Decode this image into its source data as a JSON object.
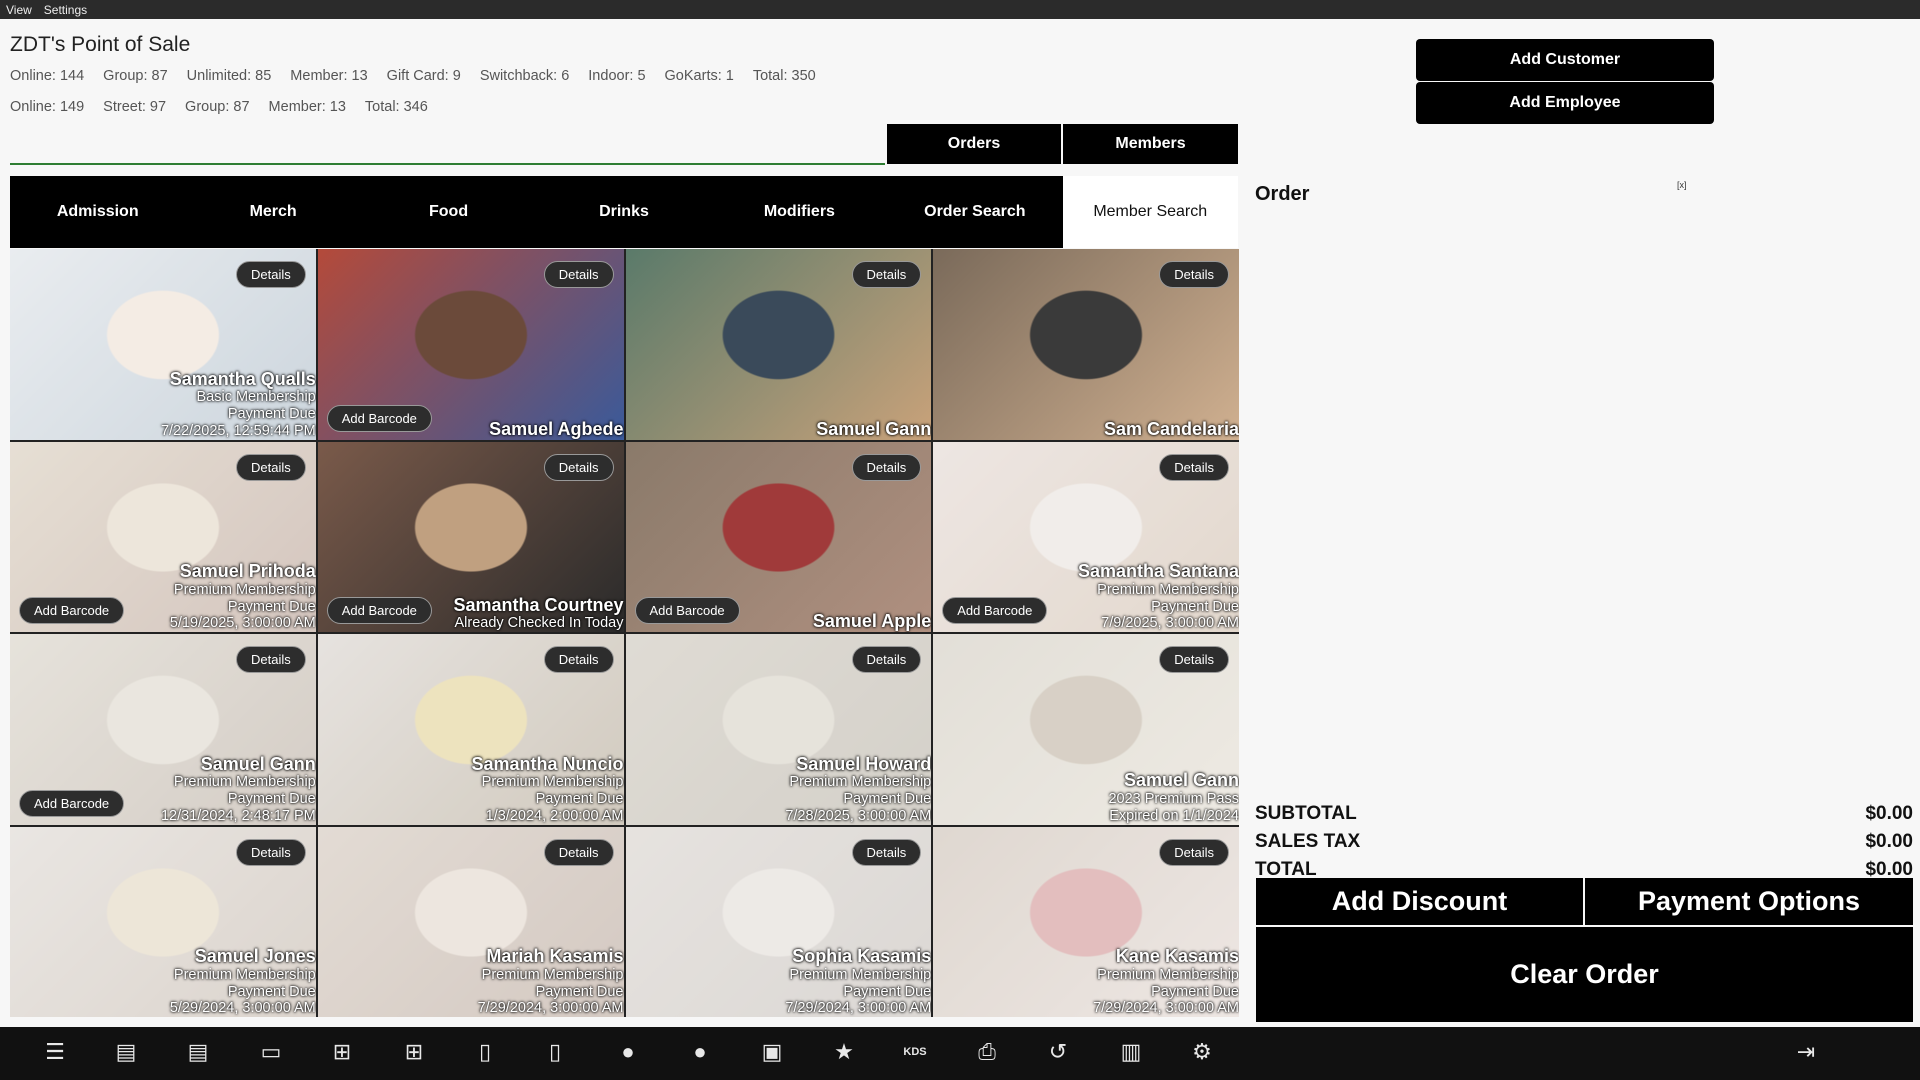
{
  "menu": [
    "View",
    "Settings"
  ],
  "app_title": "ZDT's Point of Sale",
  "stats_row1": [
    "Online: 144",
    "Group: 87",
    "Unlimited: 85",
    "Member: 13",
    "Gift Card: 9",
    "Switchback: 6",
    "Indoor: 5",
    "GoKarts: 1",
    "Total: 350"
  ],
  "stats_row2": [
    "Online: 149",
    "Street: 97",
    "Group: 87",
    "Member: 13",
    "Total: 346"
  ],
  "top_tabs": {
    "orders": "Orders",
    "members": "Members"
  },
  "right_buttons": {
    "add_customer": "Add Customer",
    "add_employee": "Add Employee"
  },
  "categories": [
    "Admission",
    "Merch",
    "Food",
    "Drinks",
    "Modifiers",
    "Order Search",
    "Member Search"
  ],
  "active_category": "Member Search",
  "card_buttons": {
    "details": "Details",
    "add_barcode": "Add Barcode"
  },
  "members": [
    {
      "name": "Samantha Qualls",
      "lines": [
        "Basic Membership",
        "Payment Due",
        "7/22/2025, 12:59:44 PM"
      ],
      "barcode": false,
      "faded": true
    },
    {
      "name": "Samuel Agbede",
      "lines": [],
      "barcode": true,
      "faded": false
    },
    {
      "name": "Samuel Gann",
      "lines": [],
      "barcode": false,
      "faded": false
    },
    {
      "name": "Sam Candelaria",
      "lines": [],
      "barcode": false,
      "faded": false
    },
    {
      "name": "Samuel Prihoda",
      "lines": [
        "Premium Membership",
        "Payment Due",
        "5/19/2025, 3:00:00 AM"
      ],
      "barcode": true,
      "faded": true
    },
    {
      "name": "Samantha Courtney",
      "lines": [
        "Already Checked In Today"
      ],
      "barcode": true,
      "faded": false
    },
    {
      "name": "Samuel Apple",
      "lines": [],
      "barcode": true,
      "faded": false
    },
    {
      "name": "Samantha Santana",
      "lines": [
        "Premium Membership",
        "Payment Due",
        "7/9/2025, 3:00:00 AM"
      ],
      "barcode": true,
      "faded": true
    },
    {
      "name": "Samuel Gann",
      "lines": [
        "Premium Membership",
        "Payment Due",
        "12/31/2024, 2:48:17 PM"
      ],
      "barcode": true,
      "faded": true
    },
    {
      "name": "Samantha Nuncio",
      "lines": [
        "Premium Membership",
        "Payment Due",
        "1/3/2024, 2:00:00 AM"
      ],
      "barcode": false,
      "faded": true
    },
    {
      "name": "Samuel Howard",
      "lines": [
        "Premium Membership",
        "Payment Due",
        "7/28/2025, 3:00:00 AM"
      ],
      "barcode": false,
      "faded": true
    },
    {
      "name": "Samuel Gann",
      "lines": [
        "2023 Premium Pass",
        "Expired on 1/1/2024"
      ],
      "barcode": false,
      "faded": true
    },
    {
      "name": "Samuel Jones",
      "lines": [
        "Premium Membership",
        "Payment Due",
        "5/29/2024, 3:00:00 AM"
      ],
      "barcode": false,
      "faded": true
    },
    {
      "name": "Mariah Kasamis",
      "lines": [
        "Premium Membership",
        "Payment Due",
        "7/29/2024, 3:00:00 AM"
      ],
      "barcode": false,
      "faded": true
    },
    {
      "name": "Sophia Kasamis",
      "lines": [
        "Premium Membership",
        "Payment Due",
        "7/29/2024, 3:00:00 AM"
      ],
      "barcode": false,
      "faded": true
    },
    {
      "name": "Kane Kasamis",
      "lines": [
        "Premium Membership",
        "Payment Due",
        "7/29/2024, 3:00:00 AM"
      ],
      "barcode": false,
      "faded": true
    }
  ],
  "order": {
    "title": "Order",
    "close": "[x]",
    "subtotal_label": "SUBTOTAL",
    "subtotal_value": "$0.00",
    "tax_label": "SALES TAX",
    "tax_value": "$0.00",
    "total_label": "TOTAL",
    "total_value": "$0.00"
  },
  "actions": {
    "add_discount": "Add Discount",
    "payment_options": "Payment Options",
    "clear_order": "Clear Order"
  },
  "toolbar": [
    {
      "icon": "menu-icon",
      "glyph": "☰"
    },
    {
      "icon": "register-icon",
      "glyph": "▤"
    },
    {
      "icon": "register-alt-icon",
      "glyph": "▤"
    },
    {
      "icon": "book-icon",
      "glyph": "▭"
    },
    {
      "icon": "add-book-icon",
      "glyph": "⊞"
    },
    {
      "icon": "add-book-alt-icon",
      "glyph": "⊞"
    },
    {
      "icon": "document-icon",
      "glyph": "▯"
    },
    {
      "icon": "document-alt-icon",
      "glyph": "▯"
    },
    {
      "icon": "people-icon",
      "glyph": "●"
    },
    {
      "icon": "people-alt-icon",
      "glyph": "●"
    },
    {
      "icon": "id-card-icon",
      "glyph": "▣"
    },
    {
      "icon": "star-icon",
      "glyph": "★"
    },
    {
      "icon": "kds-icon",
      "glyph": "KDS"
    },
    {
      "icon": "printer-icon",
      "glyph": "⎙"
    },
    {
      "icon": "history-icon",
      "glyph": "↺"
    },
    {
      "icon": "cash-drawer-icon",
      "glyph": "▥"
    },
    {
      "icon": "gear-icon",
      "glyph": "⚙"
    },
    {
      "icon": "logout-icon",
      "glyph": "⇥"
    }
  ],
  "colors": {
    "accent_green": "#2e7d32",
    "button_black": "#000000",
    "toolbar": "#111111"
  }
}
